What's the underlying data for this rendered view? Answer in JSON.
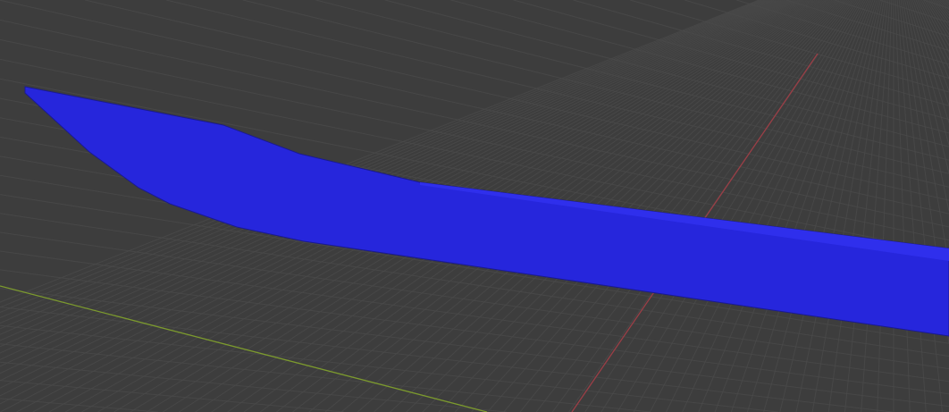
{
  "viewport": {
    "background_color": "#3d3d3d",
    "grid_color": "#4a4a4a",
    "x_axis_color": "#9a3e46",
    "y_axis_color": "#7c9a2e"
  },
  "mesh": {
    "fill_color": "#2626dc",
    "top_face_color": "#2f2fec",
    "edge_color": "#1a1a90"
  }
}
